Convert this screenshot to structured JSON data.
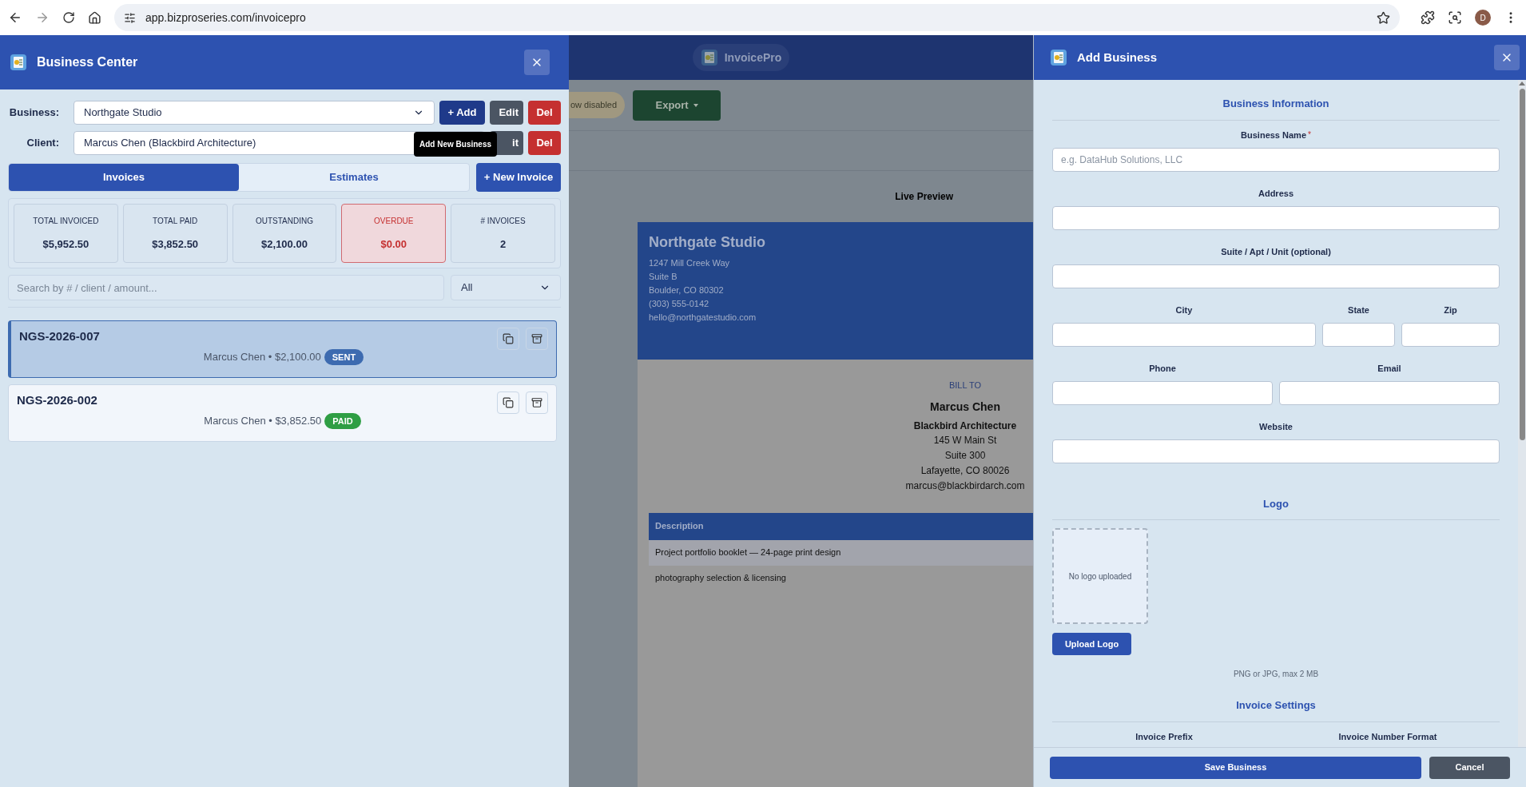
{
  "browser": {
    "url": "app.bizproseries.com/invoicepro",
    "profile_initial": "D"
  },
  "business_center": {
    "title": "Business Center",
    "business": {
      "label": "Business:",
      "value": "Northgate Studio",
      "buttons": [
        {
          "label": "+ Add",
          "kind": "add"
        },
        {
          "label": "Edit",
          "kind": "edit"
        },
        {
          "label": "Del",
          "kind": "delete"
        }
      ]
    },
    "client": {
      "label": "Client:",
      "value": "Marcus Chen (Blackbird Architecture)",
      "buttons": [
        {
          "label": "it",
          "kind": "edit"
        },
        {
          "label": "Del",
          "kind": "delete"
        }
      ]
    },
    "tooltip": "Add New Business",
    "tabs": [
      {
        "label": "Invoices",
        "selected": true
      },
      {
        "label": "Estimates",
        "selected": false
      }
    ],
    "new_button": "+ New Invoice",
    "stats": [
      {
        "label": "TOTAL INVOICED",
        "value": "$5,952.50",
        "alert": false
      },
      {
        "label": "TOTAL PAID",
        "value": "$3,852.50",
        "alert": false
      },
      {
        "label": "OUTSTANDING",
        "value": "$2,100.00",
        "alert": false
      },
      {
        "label": "OVERDUE",
        "value": "$0.00",
        "alert": true
      },
      {
        "label": "# INVOICES",
        "value": "2",
        "alert": false
      }
    ],
    "search": {
      "placeholder": "Search by # / client / amount..."
    },
    "filter": "All",
    "invoices": [
      {
        "number": "NGS-2026-007",
        "summary": "Marcus Chen • $2,100.00",
        "status": "SENT",
        "color": "#3d6bb0",
        "selected": true
      },
      {
        "number": "NGS-2026-002",
        "summary": "Marcus Chen • $3,852.50",
        "status": "PAID",
        "color": "#2f9e44",
        "selected": false
      }
    ]
  },
  "app": {
    "title": "InvoicePro",
    "pill": "ow disabled",
    "export": "Export",
    "preview_title": "Live Preview",
    "invoice": {
      "business_name": "Northgate Studio",
      "business_lines": [
        "1247 Mill Creek Way",
        "Suite B",
        "Boulder, CO 80302",
        "(303) 555-0142",
        "hello@northgatestudio.com"
      ],
      "bill_to_label": "BILL TO",
      "client_name": "Marcus Chen",
      "client_company": "Blackbird Architecture",
      "client_lines": [
        "145 W Main St",
        "Suite 300",
        "Lafayette, CO 80026",
        "marcus@blackbirdarch.com"
      ],
      "table_header": "Description",
      "rows": [
        "Project portfolio booklet — 24-page print design",
        "photography selection & licensing"
      ]
    }
  },
  "add_business": {
    "title": "Add Business",
    "sections": [
      {
        "kind": "fields",
        "title": "Business Information",
        "rows": [
          [
            {
              "label": "Business Name",
              "marker": "*",
              "placeholder": "e.g. DataHub Solutions, LLC"
            }
          ],
          [
            {
              "label": "Address"
            }
          ],
          [
            {
              "label": "Suite / Apt / Unit (optional)"
            }
          ],
          [
            {
              "label": "City"
            },
            {
              "label": "State"
            },
            {
              "label": "Zip"
            }
          ],
          [
            {
              "label": "Phone"
            },
            {
              "label": "Email"
            }
          ],
          [
            {
              "label": "Website"
            }
          ]
        ]
      },
      {
        "kind": "logo",
        "title": "Logo",
        "empty_text": "No logo uploaded",
        "button": "Upload Logo",
        "hint": "PNG or JPG, max 2 MB"
      },
      {
        "kind": "labels",
        "title": "Invoice Settings",
        "labels": [
          "Invoice Prefix",
          "Invoice Number Format"
        ]
      }
    ],
    "save": "Save Business",
    "cancel": "Cancel"
  }
}
